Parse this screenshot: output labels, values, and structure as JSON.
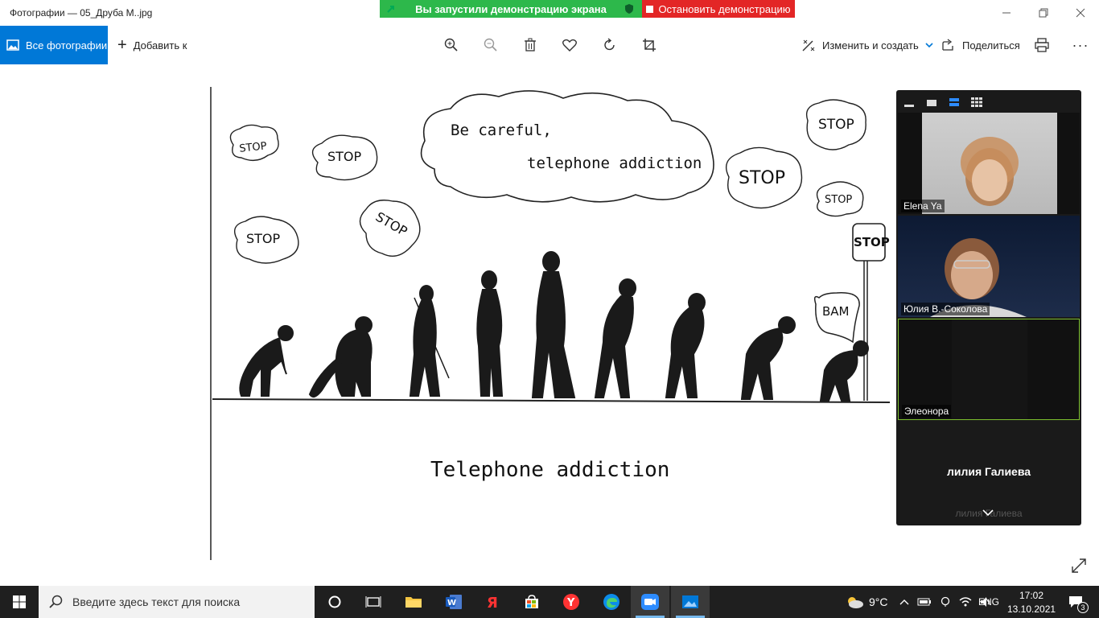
{
  "window": {
    "title": "Фотографии — 05_Друба М..jpg"
  },
  "share_banner": {
    "started_text": "Вы запустили демонстрацию экрана",
    "stop_text": "Остановить демонстрацию"
  },
  "toolbar": {
    "all_photos": "Все фотографии",
    "add_to": "Добавить к",
    "edit_create": "Изменить и создать",
    "share": "Поделиться"
  },
  "image": {
    "cloud_text_line1": "Be careful,",
    "cloud_text_line2": "telephone addiction",
    "stop_texts": [
      "STOP",
      "STOP",
      "STOP",
      "STOP",
      "STOP",
      "STOP",
      "STOP"
    ],
    "sign_text": "STOP",
    "speech_text": "BAM",
    "caption": "Telephone addiction"
  },
  "zoom": {
    "participants": [
      {
        "name": "Elena Ya"
      },
      {
        "name": "Юлия В.-Соколова"
      },
      {
        "name": "Элеонора"
      }
    ],
    "active_speaker": "лилия Галиева",
    "collapsed_name": "лилия Галиева"
  },
  "taskbar": {
    "search_placeholder": "Введите здесь текст для поиска",
    "weather": "9°C",
    "language": "ENG",
    "time": "17:02",
    "date": "13.10.2021",
    "notifications": "3"
  },
  "colors": {
    "accent": "#0078d7",
    "share_green": "#2db84b",
    "share_red": "#e32626",
    "taskbar": "#1f1f1f"
  }
}
